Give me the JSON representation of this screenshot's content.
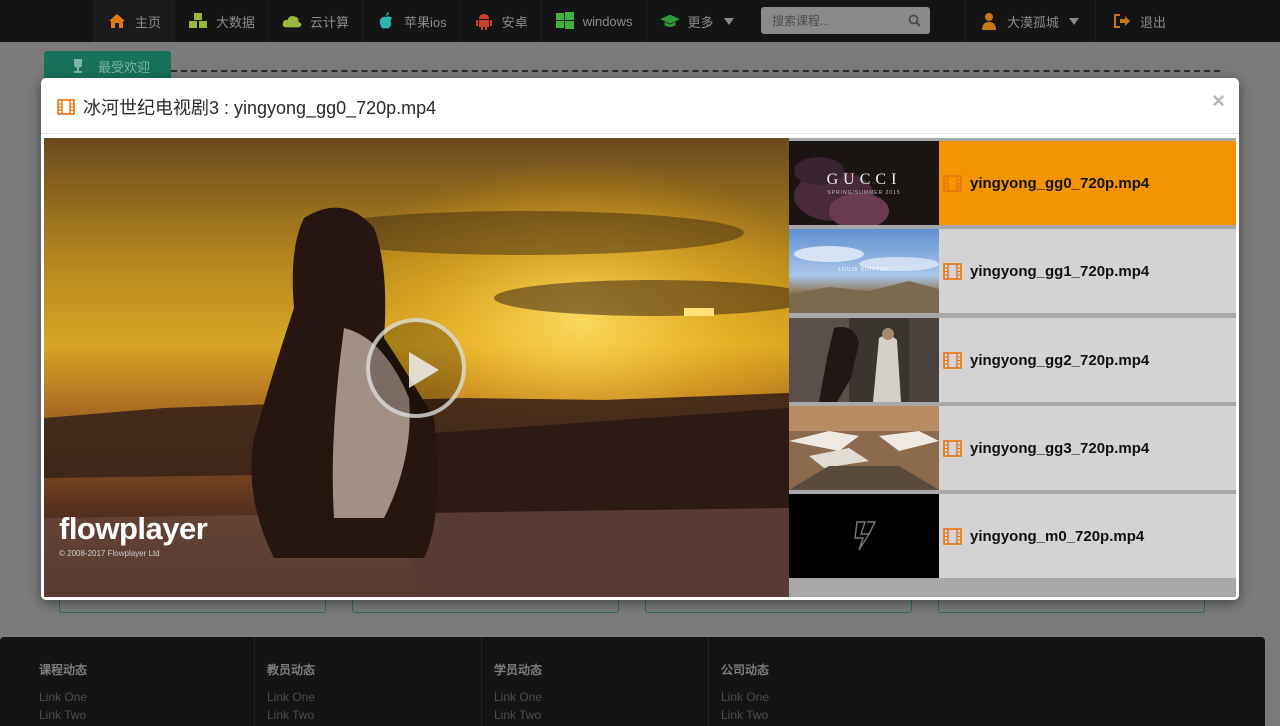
{
  "nav": {
    "items": [
      {
        "label": "主页",
        "icon": "home-icon"
      },
      {
        "label": "大数据",
        "icon": "cubes-icon"
      },
      {
        "label": "云计算",
        "icon": "cloud-icon"
      },
      {
        "label": "苹果ios",
        "icon": "apple-icon"
      },
      {
        "label": "安卓",
        "icon": "android-icon"
      },
      {
        "label": "windows",
        "icon": "windows-icon"
      },
      {
        "label": "更多",
        "icon": "graduation-cap-icon"
      }
    ],
    "search_placeholder": "搜索课程...",
    "user_label": "大漠孤城",
    "logout_label": "退出"
  },
  "page": {
    "popular_tab_label": "最受欢迎"
  },
  "modal": {
    "title": "冰河世纪电视剧3 : yingyong_gg0_720p.mp4",
    "close_label": "×"
  },
  "player": {
    "logo": "flowplayer",
    "copyright": "© 2008-2017 Flowplayer Ltd"
  },
  "playlist": [
    {
      "label": "yingyong_gg0_720p.mp4",
      "active": true,
      "thumb_text": "GUCCI",
      "thumb_subtext": "SPRING/SUMMER 2015"
    },
    {
      "label": "yingyong_gg1_720p.mp4",
      "active": false,
      "thumb_text": "LOUIS VUITTON"
    },
    {
      "label": "yingyong_gg2_720p.mp4",
      "active": false
    },
    {
      "label": "yingyong_gg3_720p.mp4",
      "active": false
    },
    {
      "label": "yingyong_m0_720p.mp4",
      "active": false
    }
  ],
  "footer": {
    "columns": [
      {
        "title": "课程动态",
        "links": [
          "Link One",
          "Link Two"
        ]
      },
      {
        "title": "教员动态",
        "links": [
          "Link One",
          "Link Two"
        ]
      },
      {
        "title": "学员动态",
        "links": [
          "Link One",
          "Link Two"
        ]
      },
      {
        "title": "公司动态",
        "links": [
          "Link One",
          "Link Two"
        ]
      }
    ]
  },
  "colors": {
    "accent_orange": "#f39500",
    "nav_bg": "#141414",
    "popular_tab": "#18725b",
    "film_icon": "#e8730c"
  }
}
